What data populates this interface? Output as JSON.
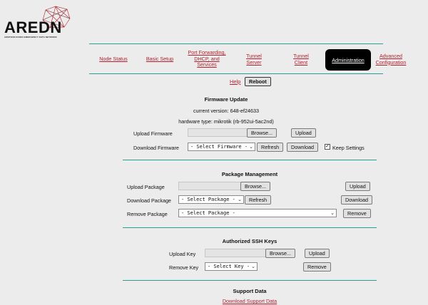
{
  "header": {
    "logo_text": "AREDN",
    "logo_tagline": "AMATEUR RADIO EMERGENCY DATA NETWORK",
    "logo_icon": "network-globe-icon"
  },
  "nav": {
    "node_status": "Node Status",
    "basic_setup": "Basic Setup",
    "port_forwarding": "Port Forwarding, DHCP, and Services",
    "tunnel_server": "Tunnel Server",
    "tunnel_client": "Tunnel Client",
    "administration": "Administration",
    "advanced_configuration": "Advanced Configuration"
  },
  "toolbar": {
    "help": "Help",
    "reboot": "Reboot"
  },
  "firmware": {
    "title": "Firmware Update",
    "current_version": "current version: 648-ef24633",
    "hardware_type": "hardware type: mikrotik (rb-952ui-5ac2nd)",
    "upload_label": "Upload Firmware",
    "browse": "Browse...",
    "upload_button": "Upload",
    "download_label": "Download Firmware",
    "select_value": "- Select Firmware -",
    "refresh": "Refresh",
    "download_button": "Download",
    "keep_settings": "Keep Settings",
    "keep_settings_checked": true
  },
  "packages": {
    "title": "Package Management",
    "upload_label": "Upload Package",
    "browse": "Browse...",
    "upload_button": "Upload",
    "download_label": "Download Package",
    "download_select": "- Select Package -",
    "refresh": "Refresh",
    "download_button": "Download",
    "remove_label": "Remove Package",
    "remove_select": "- Select Package -",
    "remove_button": "Remove"
  },
  "ssh": {
    "title": "Authorized SSH Keys",
    "upload_label": "Upload Key",
    "browse": "Browse...",
    "upload_button": "Upload",
    "remove_label": "Remove Key",
    "remove_select": "- Select Key -",
    "remove_button": "Remove"
  },
  "support": {
    "title": "Support Data",
    "download_link": "Download Support Data"
  },
  "colors": {
    "accent_rule": "#2a9d95",
    "link": "#b3212e",
    "active_tab_bg": "#000000"
  }
}
